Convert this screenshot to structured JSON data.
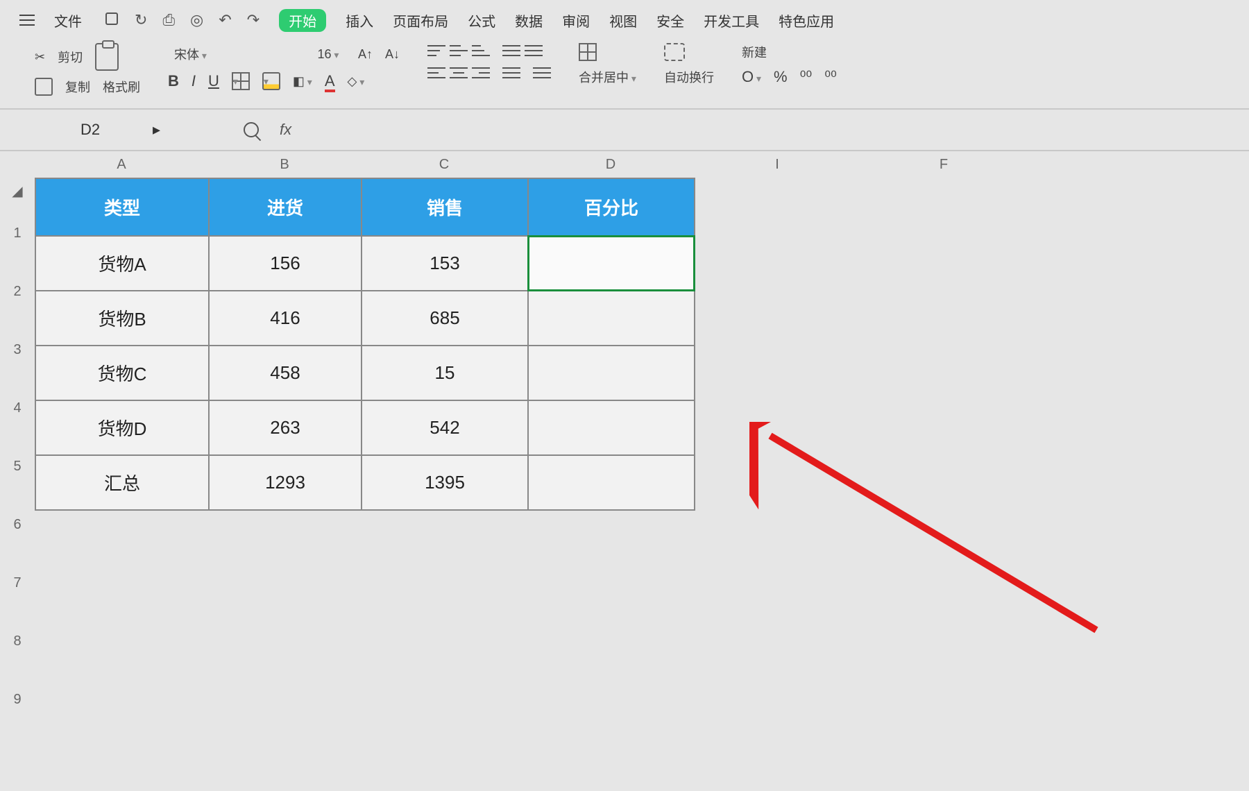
{
  "menu": {
    "file": "文件",
    "items": [
      "开始",
      "插入",
      "页面布局",
      "公式",
      "数据",
      "审阅",
      "视图",
      "安全",
      "开发工具",
      "特色应用"
    ]
  },
  "ribbon": {
    "cut": "剪切",
    "copy": "复制",
    "format_painter": "格式刷",
    "font_name": "宋体",
    "font_size": "16",
    "merge_center": "合并居中",
    "wrap_text": "自动换行",
    "new": "新建",
    "currency": "O",
    "percent": "%",
    "inc_dec_a": "⁰⁰",
    "inc_dec_b": "⁰⁰"
  },
  "formula_bar": {
    "cell_ref": "D2",
    "fx": "fx",
    "formula": ""
  },
  "columns": [
    "A",
    "B",
    "C",
    "D",
    "I",
    "F"
  ],
  "column_widths": {
    "A": 250,
    "B": 220,
    "C": 240,
    "D": 240,
    "I": 240,
    "F": 240
  },
  "rows": [
    "1",
    "2",
    "3",
    "4",
    "5",
    "6",
    "7",
    "8",
    "9"
  ],
  "table": {
    "headers": [
      "类型",
      "进货",
      "销售",
      "百分比"
    ],
    "data": [
      {
        "type": "货物A",
        "in": "156",
        "out": "153",
        "pct": ""
      },
      {
        "type": "货物B",
        "in": "416",
        "out": "685",
        "pct": ""
      },
      {
        "type": "货物C",
        "in": "458",
        "out": "15",
        "pct": ""
      },
      {
        "type": "货物D",
        "in": "263",
        "out": "542",
        "pct": ""
      },
      {
        "type": "汇总",
        "in": "1293",
        "out": "1395",
        "pct": ""
      }
    ]
  },
  "selected_cell": "D2",
  "colors": {
    "header_bg": "#2e9fe6",
    "active_tab": "#2ecc71",
    "arrow": "#e31b1b"
  }
}
